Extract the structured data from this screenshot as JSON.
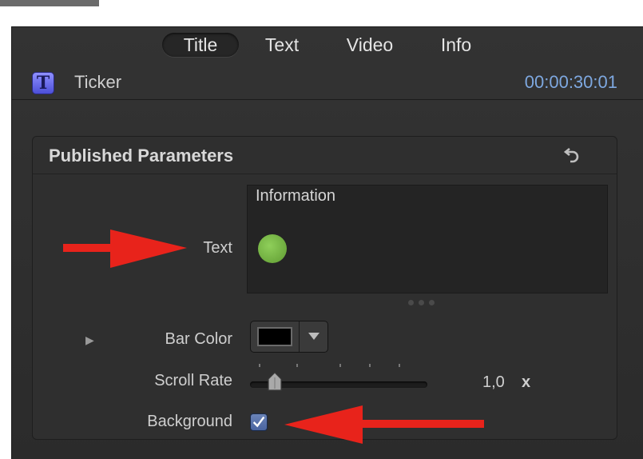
{
  "tabs": [
    {
      "label": "Title",
      "active": true
    },
    {
      "label": "Text",
      "active": false
    },
    {
      "label": "Video",
      "active": false
    },
    {
      "label": "Info",
      "active": false
    }
  ],
  "header": {
    "icon_letter": "T",
    "clip_name": "Ticker",
    "timecode": "00:00:30:01"
  },
  "section": {
    "title": "Published Parameters",
    "reset_icon": "undo-arrow-icon"
  },
  "params": {
    "text_label": "Text",
    "text_value": "Information",
    "bar_color_label": "Bar Color",
    "bar_color_value": "#000000",
    "scroll_rate_label": "Scroll Rate",
    "scroll_rate_value": "1,0",
    "scroll_rate_unit": "x",
    "background_label": "Background",
    "background_checked": true
  },
  "colors": {
    "panel_bg": "#2f2f2f",
    "timecode": "#7ea8e0",
    "annotation_arrow": "#e8231b",
    "indicator_dot": "#77b547"
  }
}
